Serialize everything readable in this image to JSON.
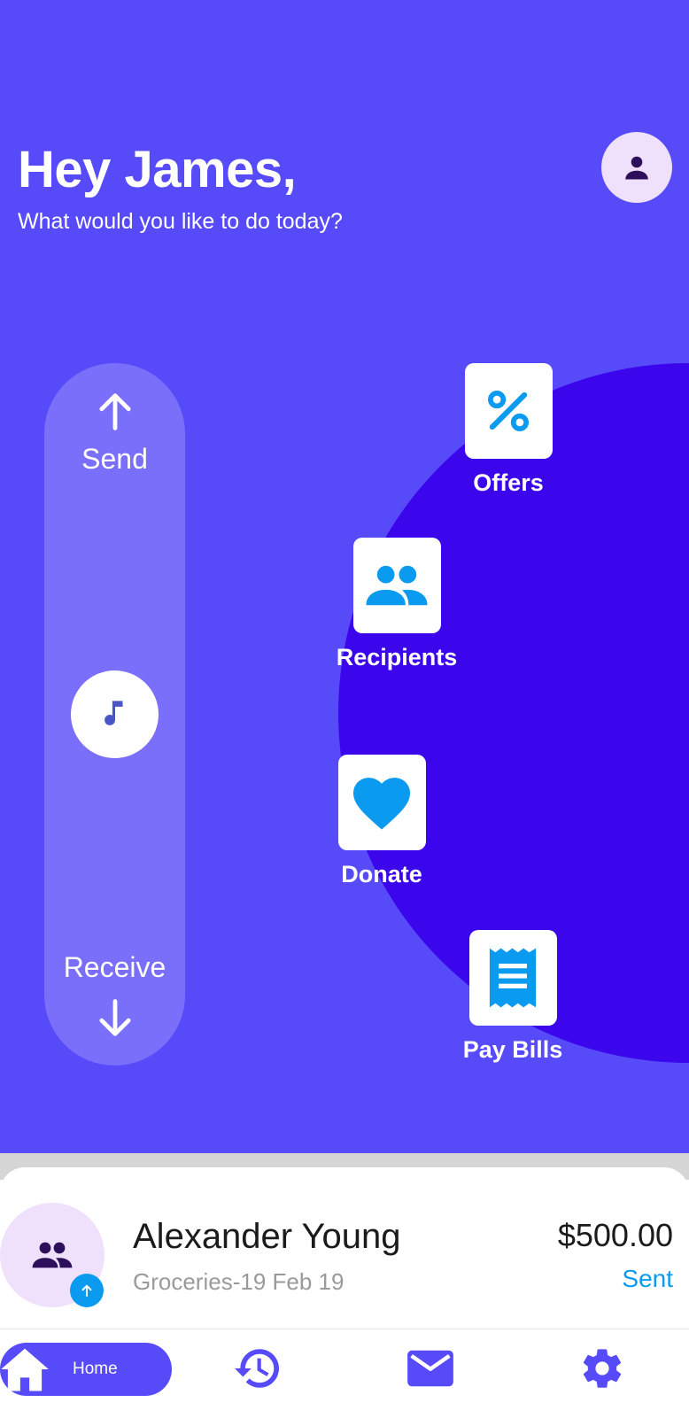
{
  "header": {
    "greeting": "Hey James,",
    "subtitle": "What would you like to do today?"
  },
  "transfer": {
    "send_label": "Send",
    "receive_label": "Receive"
  },
  "actions": [
    {
      "label": "Offers",
      "icon": "percent-icon"
    },
    {
      "label": "Recipients",
      "icon": "people-icon"
    },
    {
      "label": "Donate",
      "icon": "heart-icon"
    },
    {
      "label": "Pay Bills",
      "icon": "receipt-icon"
    }
  ],
  "recent_transaction": {
    "name": "Alexander Young",
    "detail": "Groceries-19 Feb 19",
    "amount": "$500.00",
    "status": "Sent"
  },
  "nav": {
    "home_label": "Home",
    "items": [
      "home-icon",
      "history-icon",
      "mail-icon",
      "settings-icon"
    ]
  },
  "colors": {
    "primary": "#564af9",
    "deep_purple": "#3c06ed",
    "pill": "#7a6ffb",
    "accent_blue": "#0a9bf0",
    "avatar_bg": "#efe0fb",
    "icon_dark": "#2d0f5c"
  }
}
